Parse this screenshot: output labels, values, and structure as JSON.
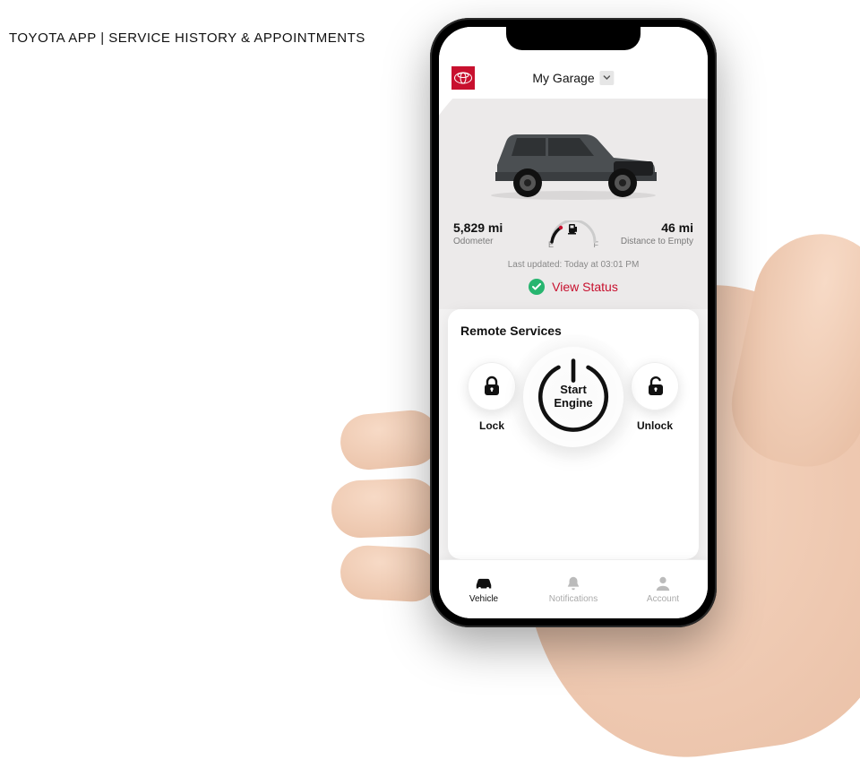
{
  "page_title": "TOYOTA APP | SERVICE HISTORY & APPOINTMENTS",
  "header": {
    "garage_label": "My Garage"
  },
  "stats": {
    "odometer_value": "5,829 mi",
    "odometer_label": "Odometer",
    "fuel_empty_letter": "E",
    "fuel_full_letter": "F",
    "dte_value": "46 mi",
    "dte_label": "Distance to Empty"
  },
  "updated_text": "Last updated:  Today at 03:01 PM",
  "status_link": "View Status",
  "remote": {
    "title": "Remote Services",
    "engine_line1": "Start",
    "engine_line2": "Engine",
    "lock_label": "Lock",
    "unlock_label": "Unlock"
  },
  "tabs": {
    "vehicle": "Vehicle",
    "notifications": "Notifications",
    "account": "Account"
  },
  "colors": {
    "brand_red": "#C8102E",
    "success_green": "#27b56f"
  }
}
